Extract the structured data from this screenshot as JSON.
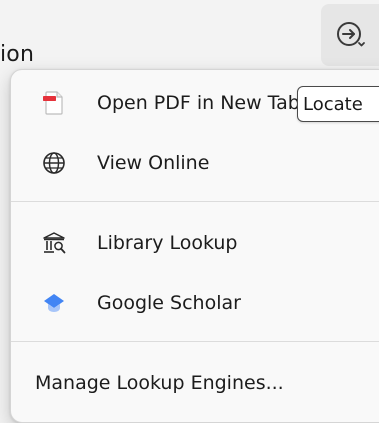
{
  "header": {
    "partial_text": "ion",
    "locate_button_icon": "locate-arrow-icon"
  },
  "menu": {
    "items": [
      {
        "label": "Open PDF in New Tab",
        "icon": "pdf-document-icon"
      },
      {
        "label": "View Online",
        "icon": "globe-icon"
      },
      {
        "label": "Library Lookup",
        "icon": "library-building-icon"
      },
      {
        "label": "Google Scholar",
        "icon": "google-scholar-icon"
      },
      {
        "label": "Manage Lookup Engines...",
        "icon": ""
      }
    ]
  },
  "tooltip": {
    "text": "Locate"
  },
  "colors": {
    "pdf_red": "#e5323b",
    "scholar_blue": "#4285f4",
    "text": "#1c1c1c"
  }
}
